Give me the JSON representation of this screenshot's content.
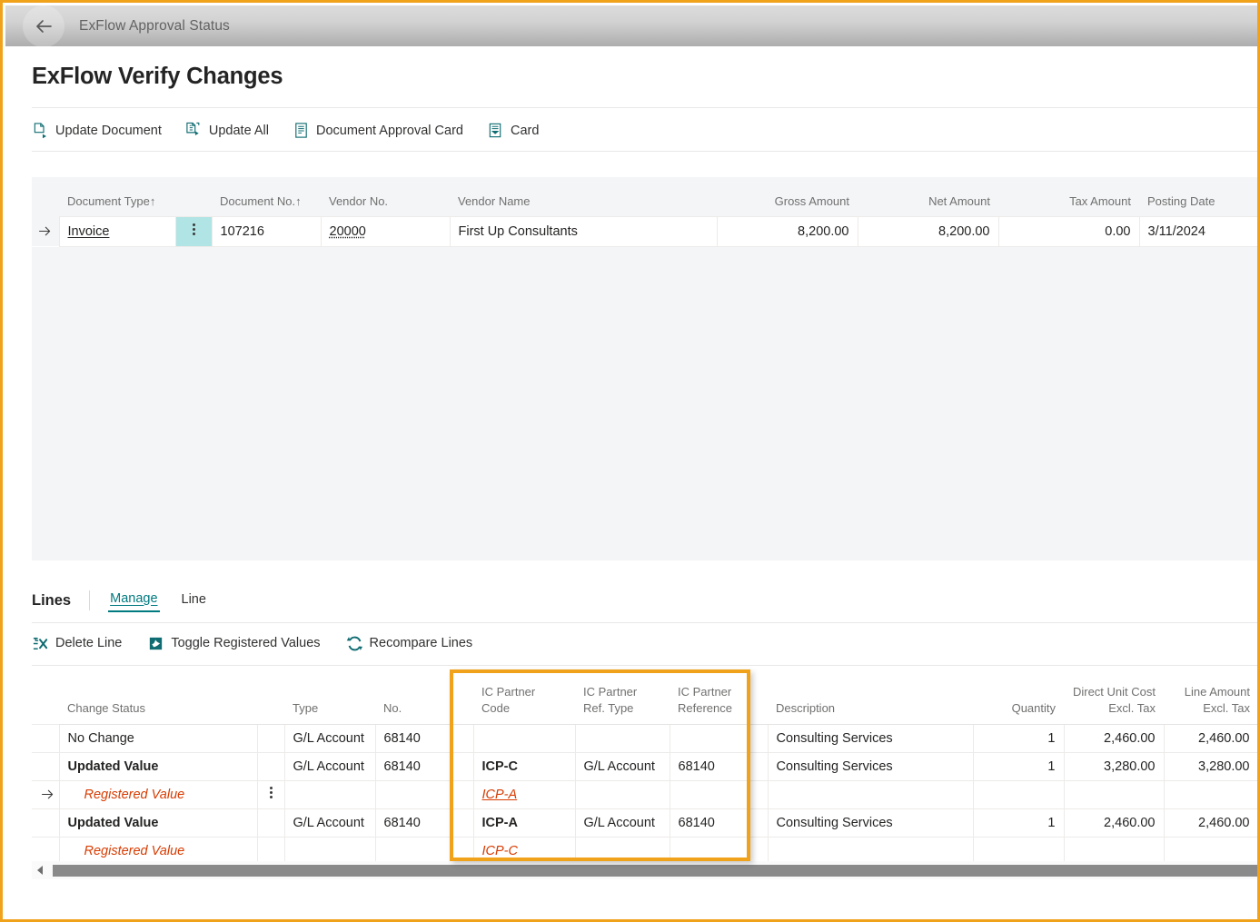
{
  "window": {
    "accent_orange": "#F0A21A",
    "accent_teal": "#007A80",
    "row_highlight": "#B1E4E4",
    "registered_red": "#D83B01"
  },
  "topbar": {
    "back_icon": "back-arrow-icon",
    "breadcrumb": "ExFlow Approval Status"
  },
  "header": {
    "title": "ExFlow Verify Changes"
  },
  "toolbar": {
    "actions": [
      {
        "label": "Update Document",
        "icon": "document-update-icon"
      },
      {
        "label": "Update All",
        "icon": "documents-update-all-icon"
      },
      {
        "label": "Document Approval Card",
        "icon": "approval-card-icon"
      },
      {
        "label": "Card",
        "icon": "card-icon"
      }
    ]
  },
  "document_grid": {
    "columns": [
      {
        "label": "Document Type",
        "sort": "↑",
        "align": "left"
      },
      {
        "label": "Document No.",
        "sort": "↑",
        "align": "left"
      },
      {
        "label": "Vendor No.",
        "sort": "",
        "align": "left"
      },
      {
        "label": "Vendor Name",
        "sort": "",
        "align": "left"
      },
      {
        "label": "Gross Amount",
        "sort": "",
        "align": "right"
      },
      {
        "label": "Net Amount",
        "sort": "",
        "align": "right"
      },
      {
        "label": "Tax Amount",
        "sort": "",
        "align": "right"
      },
      {
        "label": "Posting Date",
        "sort": "",
        "align": "left"
      }
    ],
    "rows": [
      {
        "selected": true,
        "document_type": "Invoice",
        "document_no": "107216",
        "vendor_no": "20000",
        "vendor_name": "First Up Consultants",
        "gross_amount": "8,200.00",
        "net_amount": "8,200.00",
        "tax_amount": "0.00",
        "posting_date": "3/11/2024"
      }
    ]
  },
  "lines": {
    "section_label": "Lines",
    "tabs": [
      {
        "label": "Manage",
        "active": true
      },
      {
        "label": "Line",
        "active": false
      }
    ],
    "actions": [
      {
        "label": "Delete Line",
        "icon": "delete-line-icon"
      },
      {
        "label": "Toggle Registered Values",
        "icon": "toggle-registered-values-icon"
      },
      {
        "label": "Recompare Lines",
        "icon": "recompare-lines-icon"
      }
    ],
    "columns": [
      {
        "label": "Change Status",
        "line2": "",
        "align": "left"
      },
      {
        "label": "Type",
        "line2": "",
        "align": "left"
      },
      {
        "label": "No.",
        "line2": "",
        "align": "left"
      },
      {
        "label": "IC Partner",
        "line2": "Code",
        "align": "left"
      },
      {
        "label": "IC Partner",
        "line2": "Ref. Type",
        "align": "left"
      },
      {
        "label": "IC Partner",
        "line2": "Reference",
        "align": "left"
      },
      {
        "label": "Description",
        "line2": "",
        "align": "left"
      },
      {
        "label": "Quantity",
        "line2": "",
        "align": "right"
      },
      {
        "label": "Direct Unit Cost",
        "line2": "Excl. Tax",
        "align": "right"
      },
      {
        "label": "Line Amount",
        "line2": "Excl. Tax",
        "align": "right"
      }
    ],
    "rows": [
      {
        "style": "normal",
        "selected": false,
        "change_status": "No Change",
        "type": "G/L Account",
        "no": "68140",
        "ic_partner_code": "",
        "ic_partner_ref_type": "",
        "ic_partner_reference": "",
        "description": "Consulting Services",
        "quantity": "1",
        "direct_unit_cost": "2,460.00",
        "line_amount": "2,460.00"
      },
      {
        "style": "updated",
        "selected": false,
        "change_status": "Updated Value",
        "type": "G/L Account",
        "no": "68140",
        "ic_partner_code": "ICP-C",
        "ic_partner_ref_type": "G/L Account",
        "ic_partner_reference": "68140",
        "description": "Consulting Services",
        "quantity": "1",
        "direct_unit_cost": "3,280.00",
        "line_amount": "3,280.00"
      },
      {
        "style": "registered",
        "selected": true,
        "underline_code": true,
        "change_status": "Registered Value",
        "type": "",
        "no": "",
        "ic_partner_code": "ICP-A",
        "ic_partner_ref_type": "",
        "ic_partner_reference": "",
        "description": "",
        "quantity": "",
        "direct_unit_cost": "",
        "line_amount": ""
      },
      {
        "style": "updated",
        "selected": false,
        "change_status": "Updated Value",
        "type": "G/L Account",
        "no": "68140",
        "ic_partner_code": "ICP-A",
        "ic_partner_ref_type": "G/L Account",
        "ic_partner_reference": "68140",
        "description": "Consulting Services",
        "quantity": "1",
        "direct_unit_cost": "2,460.00",
        "line_amount": "2,460.00"
      },
      {
        "style": "registered",
        "selected": false,
        "underline_code": false,
        "change_status": "Registered Value",
        "type": "",
        "no": "",
        "ic_partner_code": "ICP-C",
        "ic_partner_ref_type": "",
        "ic_partner_reference": "",
        "description": "",
        "quantity": "",
        "direct_unit_cost": "",
        "line_amount": ""
      }
    ]
  },
  "scrollbar": {
    "left_arrow_icon": "scroll-left-arrow-icon"
  }
}
